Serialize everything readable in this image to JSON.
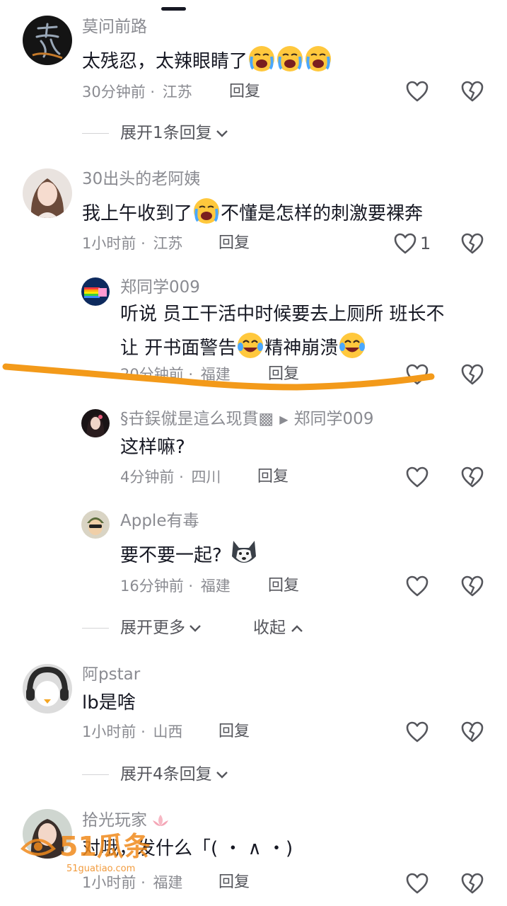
{
  "comments": [
    {
      "username": "莫问前路",
      "text": "太残忍，太辣眼睛了",
      "time": "30分钟前",
      "location": "江苏",
      "reply_label": "回复",
      "like_count": "",
      "avatar_icon": "calligraphy-avatar-icon",
      "emoji": [
        "crying-emoji",
        "crying-emoji",
        "crying-emoji"
      ]
    },
    {
      "username": "30出头的老阿姨",
      "text_before": "我上午收到了",
      "text_after": "不懂是怎样的刺激要裸奔",
      "time": "1小时前",
      "location": "江苏",
      "reply_label": "回复",
      "like_count": "1",
      "avatar_icon": "woman-portrait-icon"
    },
    {
      "username": "阿pstar",
      "text": "lb是啥",
      "time": "1小时前",
      "location": "山西",
      "reply_label": "回复",
      "avatar_icon": "headphone-avatar-icon"
    },
    {
      "username": "拾光玩家",
      "text": "对哦，发什么「( ・ ∧ ・)",
      "time": "1小时前",
      "location": "福建",
      "reply_label": "回复",
      "avatar_icon": "girl-portrait-icon"
    }
  ],
  "replies": [
    {
      "username": "郑同学009",
      "line1": "听说 员工干活中时候要去上厕所 班长不",
      "line2_a": "让 开书面警告",
      "line2_b": "精神崩溃",
      "time": "20分钟前",
      "location": "福建",
      "reply_label": "回复"
    },
    {
      "username": "§卋鋘僦昰這么现貫▩",
      "reply_to": "郑同学009",
      "text": "这样嘛?",
      "time": "4分钟前",
      "location": "四川",
      "reply_label": "回复"
    },
    {
      "username": "Apple有毒",
      "text": "要不要一起?",
      "time": "16分钟前",
      "location": "福建",
      "reply_label": "回复"
    }
  ],
  "expand": {
    "first": "展开1条回复",
    "more": "展开更多",
    "collapse": "收起",
    "four": "展开4条回复"
  },
  "meta_separator": "·",
  "watermark": {
    "brand": "51瓜条",
    "url": "51guatiao.com"
  },
  "colors": {
    "highlight_stroke": "#f39a1a",
    "text_primary": "#161823",
    "text_secondary": "#8a8b91"
  }
}
